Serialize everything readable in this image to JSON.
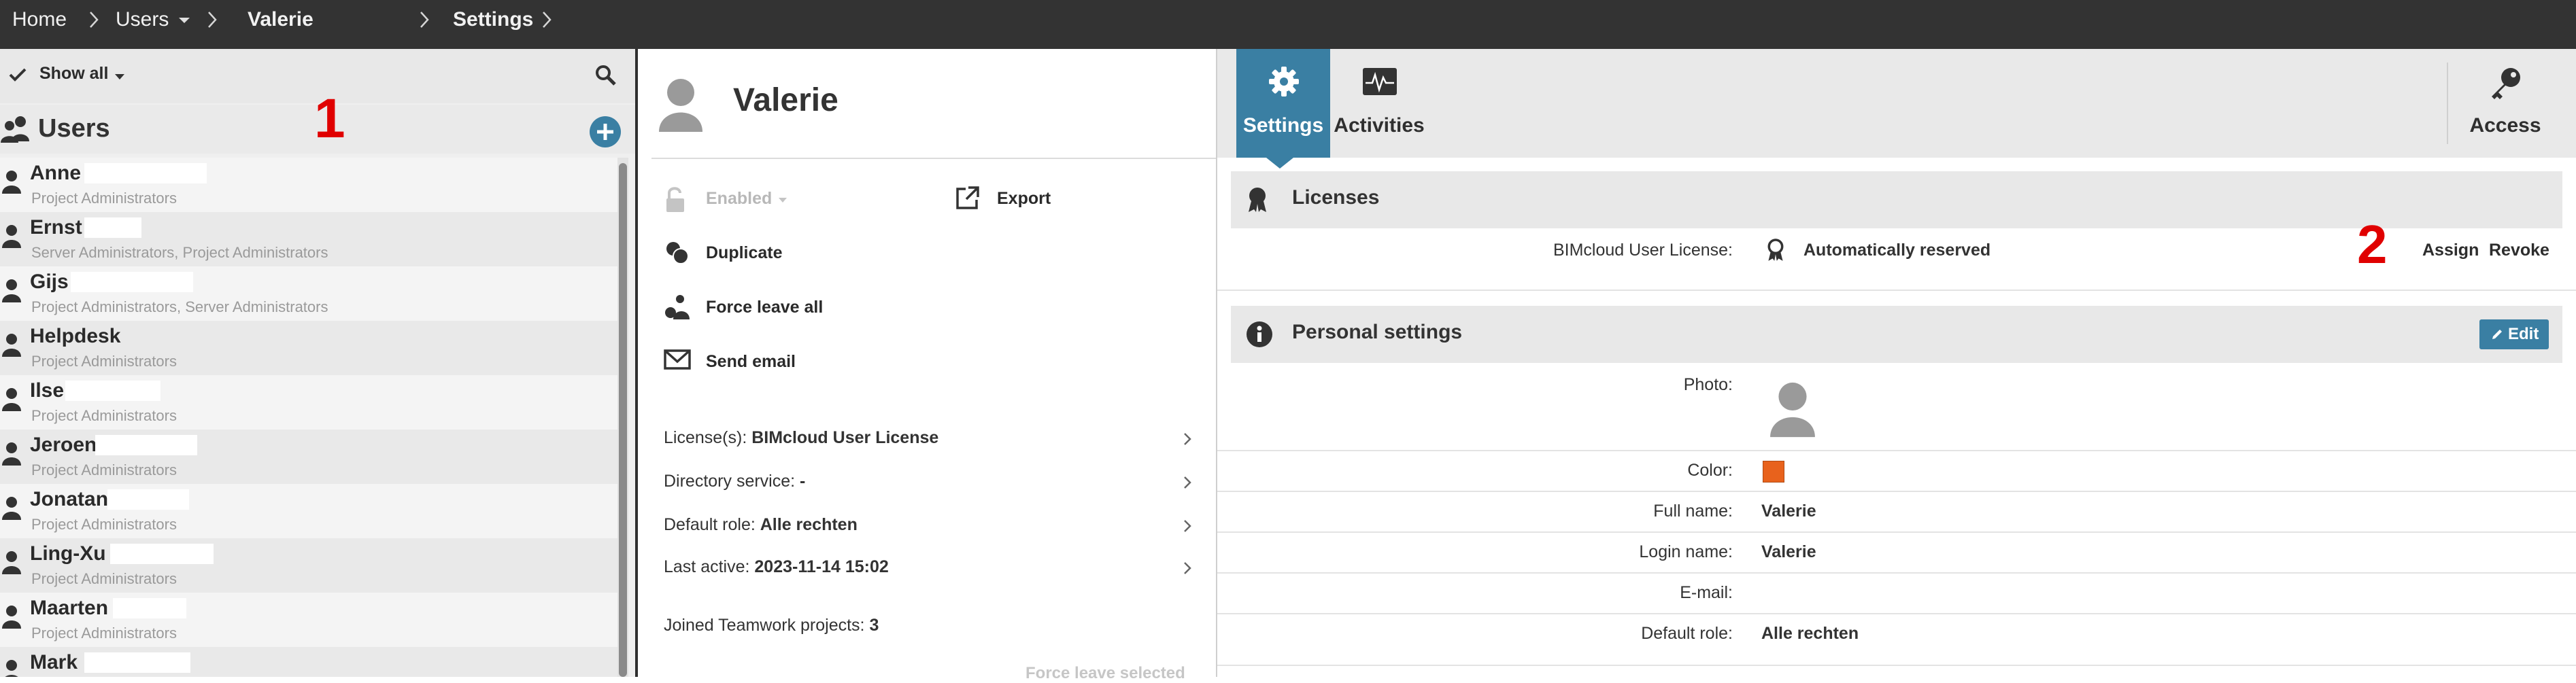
{
  "breadcrumb": {
    "items": [
      "Home",
      "Users",
      "Valerie",
      "Settings"
    ]
  },
  "left_panel": {
    "filter_label": "Show all",
    "title": "Users",
    "annotation": "1",
    "users": [
      {
        "name": "Anne",
        "groups": "Project Administrators"
      },
      {
        "name": "Ernst",
        "groups": "Server Administrators, Project Administrators"
      },
      {
        "name": "Gijs",
        "groups": "Project Administrators, Server Administrators"
      },
      {
        "name": "Helpdesk",
        "groups": "Project Administrators"
      },
      {
        "name": "Ilse",
        "groups": "Project Administrators"
      },
      {
        "name": "Jeroen",
        "groups": "Project Administrators"
      },
      {
        "name": "Jonatan",
        "groups": "Project Administrators"
      },
      {
        "name": "Ling-Xu",
        "groups": "Project Administrators"
      },
      {
        "name": "Maarten",
        "groups": "Project Administrators"
      },
      {
        "name": "Mark",
        "groups": ""
      }
    ]
  },
  "middle_panel": {
    "user_name": "Valerie",
    "actions": {
      "enabled": "Enabled",
      "export": "Export",
      "duplicate": "Duplicate",
      "force_leave_all": "Force leave all",
      "send_email": "Send email"
    },
    "info": {
      "licenses_label": "License(s):",
      "licenses_value": "BIMcloud User License",
      "directory_label": "Directory service:",
      "directory_value": "-",
      "default_role_label": "Default role:",
      "default_role_value": "Alle rechten",
      "last_active_label": "Last active:",
      "last_active_value": "2023-11-14 15:02",
      "projects_label": "Joined Teamwork projects:",
      "projects_value": "3"
    },
    "partial_bottom_text": "Force leave selected"
  },
  "right_panel": {
    "tabs": {
      "settings": "Settings",
      "activities": "Activities",
      "access": "Access"
    },
    "licenses": {
      "title": "Licenses",
      "label": "BIMcloud User License:",
      "value": "Automatically reserved",
      "annotation": "2",
      "assign": "Assign",
      "revoke": "Revoke"
    },
    "personal": {
      "title": "Personal settings",
      "edit": "Edit",
      "photo_label": "Photo:",
      "color_label": "Color:",
      "color_value": "#e8621c",
      "full_name_label": "Full name:",
      "full_name_value": "Valerie",
      "login_label": "Login name:",
      "login_value": "Valerie",
      "email_label": "E-mail:",
      "email_value": "",
      "default_role_label": "Default role:",
      "default_role_value": "Alle rechten"
    }
  },
  "colors": {
    "topbar": "#333333",
    "accent": "#3a7fa3",
    "annotation": "#e00000",
    "add_button": "#3a7fa3"
  }
}
